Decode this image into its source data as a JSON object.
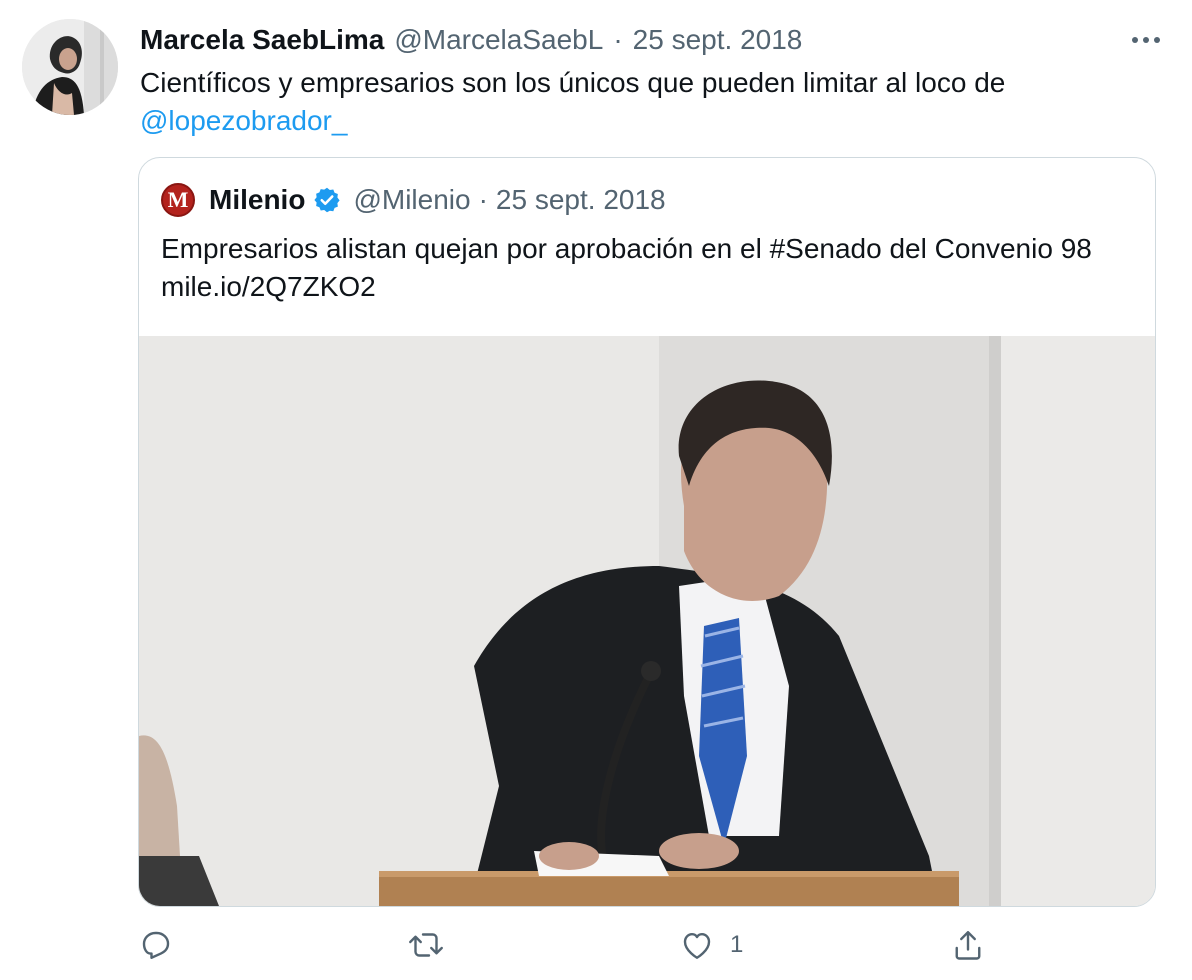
{
  "tweet": {
    "author_name": "Marcela SaebLima",
    "author_handle": "@MarcelaSaebL",
    "separator": "·",
    "date": "25 sept. 2018",
    "text": "Científicos y empresarios son los únicos que pueden limitar al loco de",
    "mention": "@lopezobrador_"
  },
  "quote": {
    "author_name": "Milenio",
    "author_handle": "@Milenio",
    "separator": "·",
    "date": "25 sept. 2018",
    "text": "Empresarios alistan quejan por aprobación en el #Senado del Convenio 98 mile.io/2Q7ZKO2",
    "logo_letter": "M",
    "verified": true
  },
  "actions": {
    "reply_count": "",
    "retweet_count": "",
    "like_count": "1",
    "share_count": ""
  },
  "icons": {
    "more": "more-icon",
    "reply": "reply-icon",
    "retweet": "retweet-icon",
    "like": "heart-icon",
    "share": "share-icon",
    "verified": "verified-badge-icon"
  },
  "colors": {
    "text": "#0f1419",
    "secondary": "#536471",
    "link": "#1d9bf0",
    "border": "#cfd9de",
    "milenio_red": "#b3221d"
  }
}
